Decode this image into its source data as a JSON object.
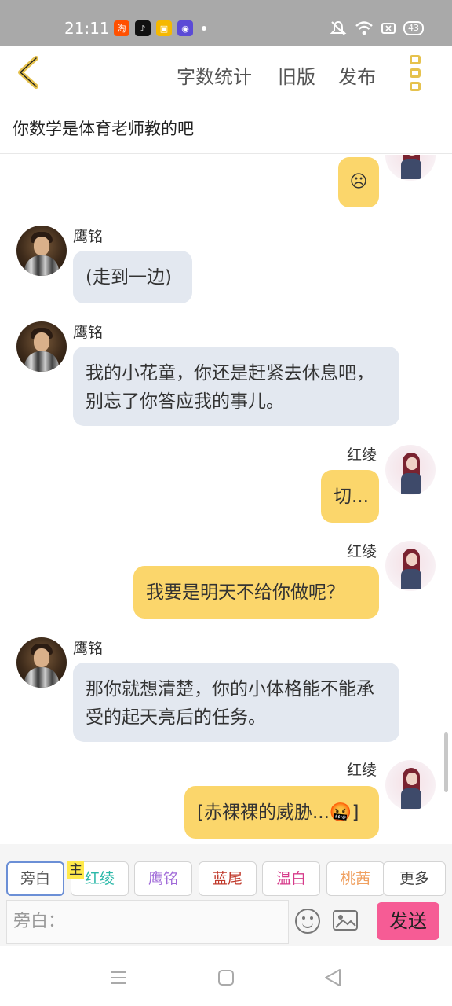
{
  "status_bar": {
    "time": "21:11",
    "battery": "43",
    "apps": [
      {
        "icon": "taobao-icon",
        "label": "淘",
        "color": "#ff5000"
      },
      {
        "icon": "douyin-icon",
        "label": "♪",
        "color": "#111111"
      },
      {
        "icon": "notes-icon",
        "label": "▣",
        "color": "#f5b800"
      },
      {
        "icon": "browser-icon",
        "label": "◉",
        "color": "#5b4ad6"
      }
    ]
  },
  "header": {
    "links": [
      "字数统计",
      "旧版",
      "发布"
    ]
  },
  "title": "你数学是体育老师教的吧",
  "messages": [
    {
      "side": "right",
      "name": "",
      "text": "☹"
    },
    {
      "side": "left",
      "name": "鹰铭",
      "text": "(走到一边)"
    },
    {
      "side": "left",
      "name": "鹰铭",
      "text": "我的小花童，你还是赶紧去休息吧，别忘了你答应我的事儿。"
    },
    {
      "side": "right",
      "name": "红绫",
      "text": "切..."
    },
    {
      "side": "right",
      "name": "红绫",
      "text": "我要是明天不给你做呢？"
    },
    {
      "side": "left",
      "name": "鹰铭",
      "text": "那你就想清楚，你的小体格能不能承受的起天亮后的任务。"
    },
    {
      "side": "right",
      "name": "红绫",
      "text": "[赤裸裸的威胁...🤬]"
    }
  ],
  "roles": [
    {
      "label": "旁白",
      "color": "#555555"
    },
    {
      "label": "红绫",
      "color": "#2bb8a8"
    },
    {
      "label": "鹰铭",
      "color": "#a06ad8"
    },
    {
      "label": "蓝尾",
      "color": "#c0392b"
    },
    {
      "label": "温白",
      "color": "#d63a8a"
    },
    {
      "label": "桃茜",
      "color": "#f0a060"
    },
    {
      "label": "更多",
      "color": "#444444"
    }
  ],
  "host_badge": "主",
  "input": {
    "placeholder": "旁白："
  },
  "send_label": "发送",
  "accent": "#e6c24d"
}
